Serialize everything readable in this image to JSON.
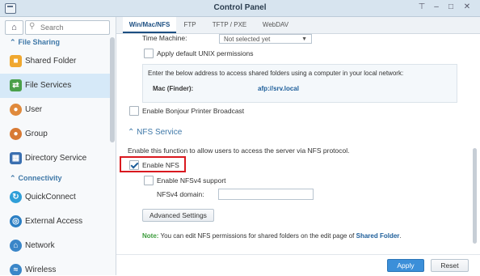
{
  "window": {
    "title": "Control Panel",
    "controls": {
      "pin": "⊤",
      "minimize": "–",
      "maximize": "□",
      "close": "✕"
    }
  },
  "sidebar": {
    "home_icon": "⌂",
    "search_placeholder": "Search",
    "sections": [
      {
        "label": "File Sharing",
        "items": [
          "Shared Folder",
          "File Services",
          "User",
          "Group",
          "Directory Service"
        ]
      },
      {
        "label": "Connectivity",
        "items": [
          "QuickConnect",
          "External Access",
          "Network",
          "Wireless"
        ]
      }
    ],
    "active_item": "File Services"
  },
  "tabs": [
    "Win/Mac/NFS",
    "FTP",
    "TFTP / PXE",
    "WebDAV"
  ],
  "active_tab": "Win/Mac/NFS",
  "afp": {
    "time_machine_label": "Time Machine:",
    "time_machine_value": "Not selected yet",
    "default_unix_label": "Apply default UNIX permissions",
    "access_note": "Enter the below address to access shared folders using a computer in your local network:",
    "mac_label": "Mac (Finder):",
    "mac_address": "afp://srv.local"
  },
  "bonjour_label": "Enable Bonjour Printer Broadcast",
  "nfs": {
    "section_title": "NFS Service",
    "description": "Enable this function to allow users to access the server via NFS protocol.",
    "enable_label": "Enable NFS",
    "enable_checked": true,
    "nfsv4_label": "Enable NFSv4 support",
    "nfsv4_domain_label": "NFSv4 domain:",
    "nfsv4_domain_value": "",
    "advanced_button": "Advanced Settings",
    "note_prefix": "Note:",
    "note_text": "You can edit NFS permissions for shared folders on the edit page of",
    "note_link": "Shared Folder",
    "note_suffix": "."
  },
  "footer": {
    "apply": "Apply",
    "reset": "Reset"
  },
  "colors": {
    "accent": "#3b8fd9",
    "highlight": "#d9191f",
    "section_title": "#3f78a8"
  },
  "icons": {
    "shared_folder": "folder-icon",
    "file_services": "file-services-icon",
    "user": "user-icon",
    "group": "group-icon",
    "directory_service": "directory-icon",
    "quickconnect": "quickconnect-icon",
    "external_access": "globe-icon",
    "network": "network-icon",
    "wireless": "wifi-icon"
  }
}
